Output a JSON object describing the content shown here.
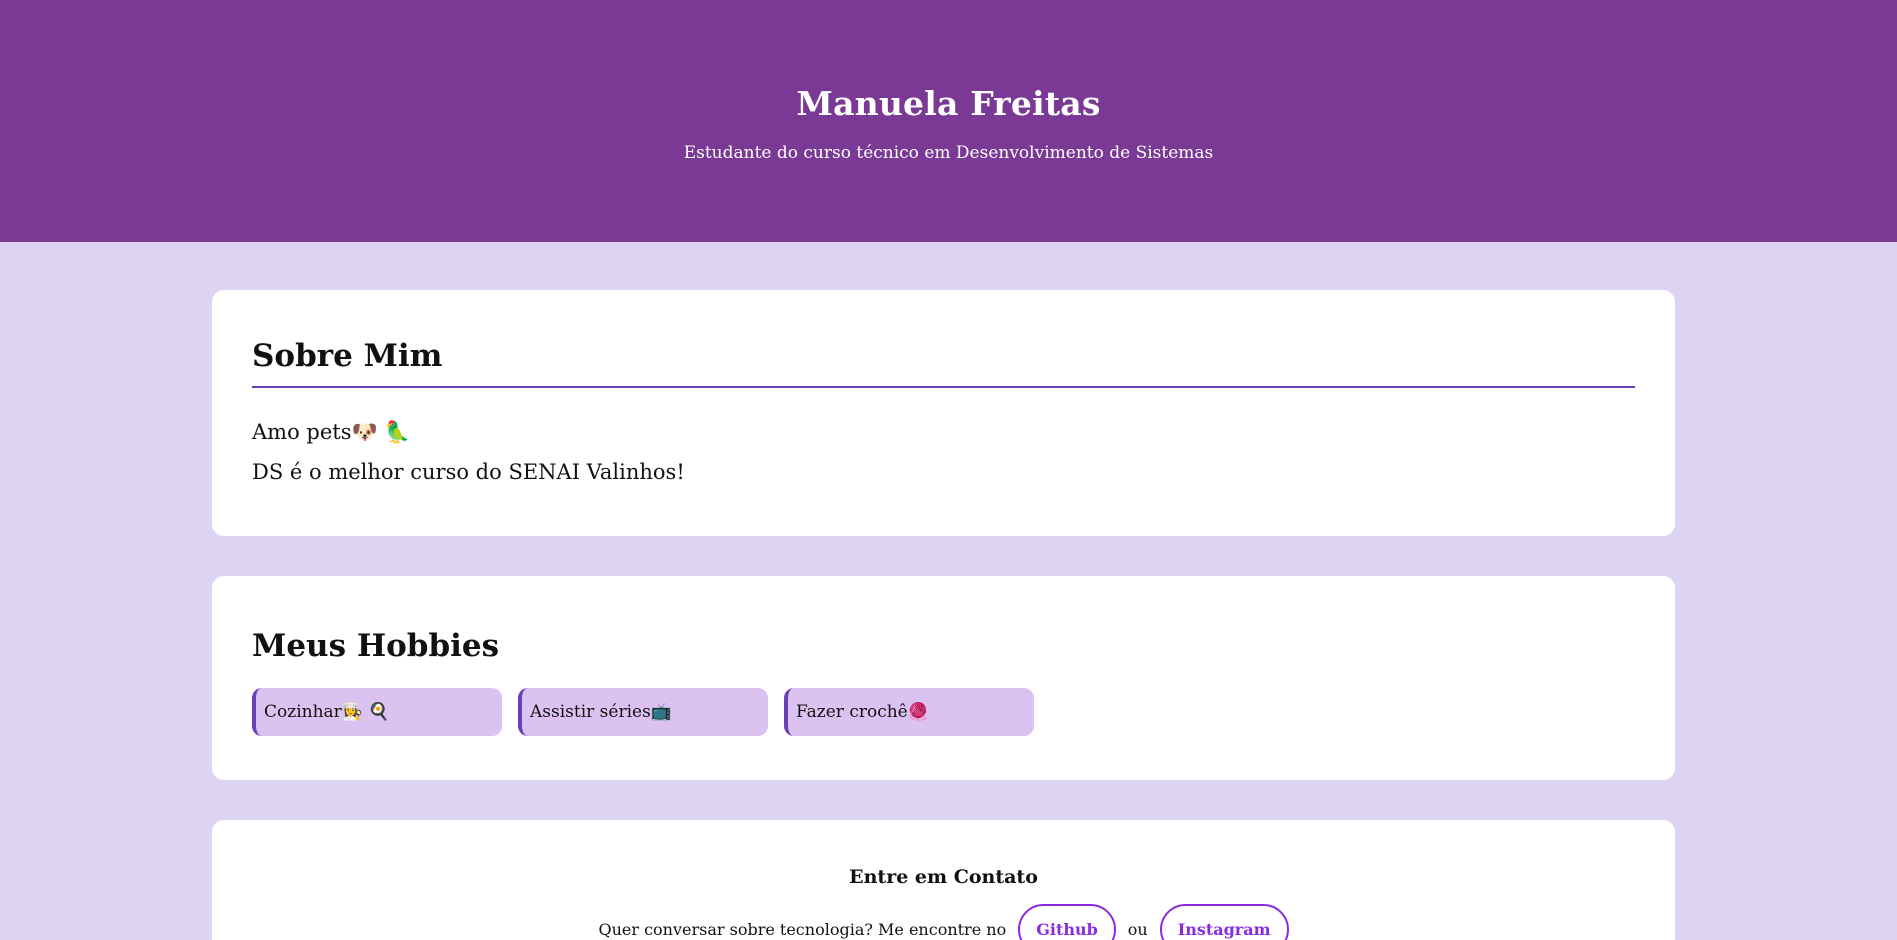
{
  "header": {
    "name": "Manuela Freitas",
    "subtitle": "Estudante do curso técnico em Desenvolvimento de Sistemas"
  },
  "about": {
    "title": "Sobre Mim",
    "line1": "Amo pets🐶 🦜",
    "line2": "DS é o melhor curso do SENAI Valinhos!"
  },
  "hobbies": {
    "title": "Meus Hobbies",
    "items": [
      {
        "label": "Cozinhar👩‍🍳 🍳"
      },
      {
        "label": "Assistir séries📺"
      },
      {
        "label": "Fazer crochê🧶"
      }
    ]
  },
  "contact": {
    "title": "Entre em Contato",
    "text": "Quer conversar sobre tecnologia? Me encontre no",
    "github_label": "Github",
    "or": "ou",
    "instagram_label": "Instagram"
  }
}
